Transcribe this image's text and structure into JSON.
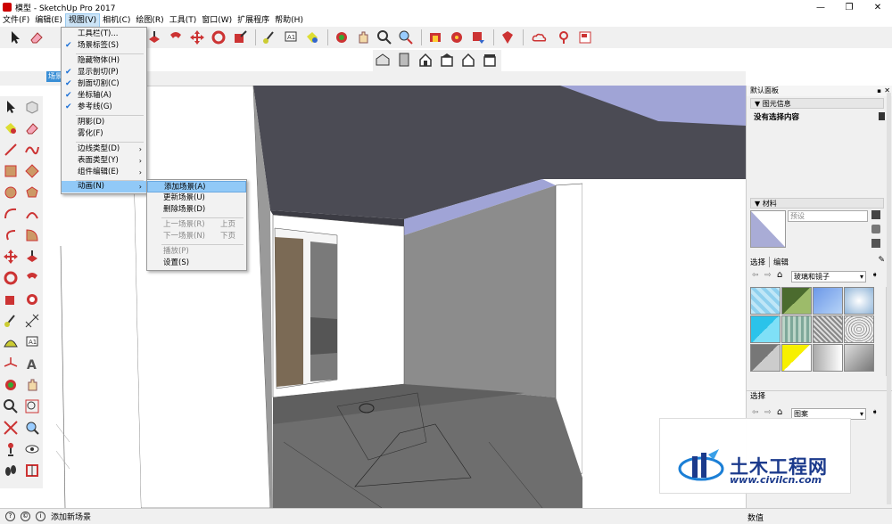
{
  "window": {
    "title": "模型 - SketchUp Pro 2017",
    "min": "—",
    "max": "❐",
    "close": "✕"
  },
  "menubar": [
    "文件(F)",
    "编辑(E)",
    "视图(V)",
    "相机(C)",
    "绘图(R)",
    "工具(T)",
    "窗口(W)",
    "扩展程序",
    "帮助(H)"
  ],
  "scene_tab": "场景",
  "view_menu": {
    "items": [
      {
        "label": "工具栏(T)...",
        "checked": false,
        "submenu": false
      },
      {
        "label": "场景标签(S)",
        "checked": true,
        "submenu": false
      },
      {
        "label": "隐藏物体(H)",
        "checked": false,
        "submenu": false
      },
      {
        "label": "显示剖切(P)",
        "checked": true,
        "submenu": false
      },
      {
        "label": "剖面切割(C)",
        "checked": true,
        "submenu": false
      },
      {
        "label": "坐标轴(A)",
        "checked": true,
        "submenu": false
      },
      {
        "label": "参考线(G)",
        "checked": true,
        "submenu": false
      },
      {
        "label": "阴影(D)",
        "checked": false,
        "submenu": false
      },
      {
        "label": "雾化(F)",
        "checked": false,
        "submenu": false
      },
      {
        "label": "边线类型(D)",
        "checked": false,
        "submenu": true
      },
      {
        "label": "表面类型(Y)",
        "checked": false,
        "submenu": true
      },
      {
        "label": "组件编辑(E)",
        "checked": false,
        "submenu": true
      },
      {
        "label": "动画(N)",
        "checked": false,
        "submenu": true
      }
    ],
    "check": "✔",
    "arrow": "›"
  },
  "anim_menu": {
    "items": [
      {
        "label": "添加场景(A)",
        "shortcut": ""
      },
      {
        "label": "更新场景(U)",
        "shortcut": ""
      },
      {
        "label": "删除场景(D)",
        "shortcut": ""
      },
      {
        "label": "上一场景(R)",
        "shortcut": "上页"
      },
      {
        "label": "下一场景(N)",
        "shortcut": "下页"
      },
      {
        "label": "播放(P)",
        "shortcut": ""
      },
      {
        "label": "设置(S)",
        "shortcut": ""
      }
    ]
  },
  "tray": {
    "title": "默认面板",
    "entity_info": {
      "header": "图元信息",
      "content": "没有选择内容"
    },
    "materials": {
      "header": "材料",
      "name_placeholder": "预设",
      "tab_select": "选择",
      "tab_edit": "编辑",
      "library": "玻璃和镜子"
    },
    "select2": {
      "header": "选择",
      "library": "图案"
    }
  },
  "status": {
    "text": "添加新场景",
    "measure_label": "数值"
  },
  "watermark": {
    "title": "土木工程网",
    "url": "www.civilcn.com"
  },
  "colors": {
    "highlight": "#91c9f7",
    "ceiling": "#4a4a52",
    "floor": "#6b6b6b",
    "wall_grey": "#8f8f8f"
  }
}
